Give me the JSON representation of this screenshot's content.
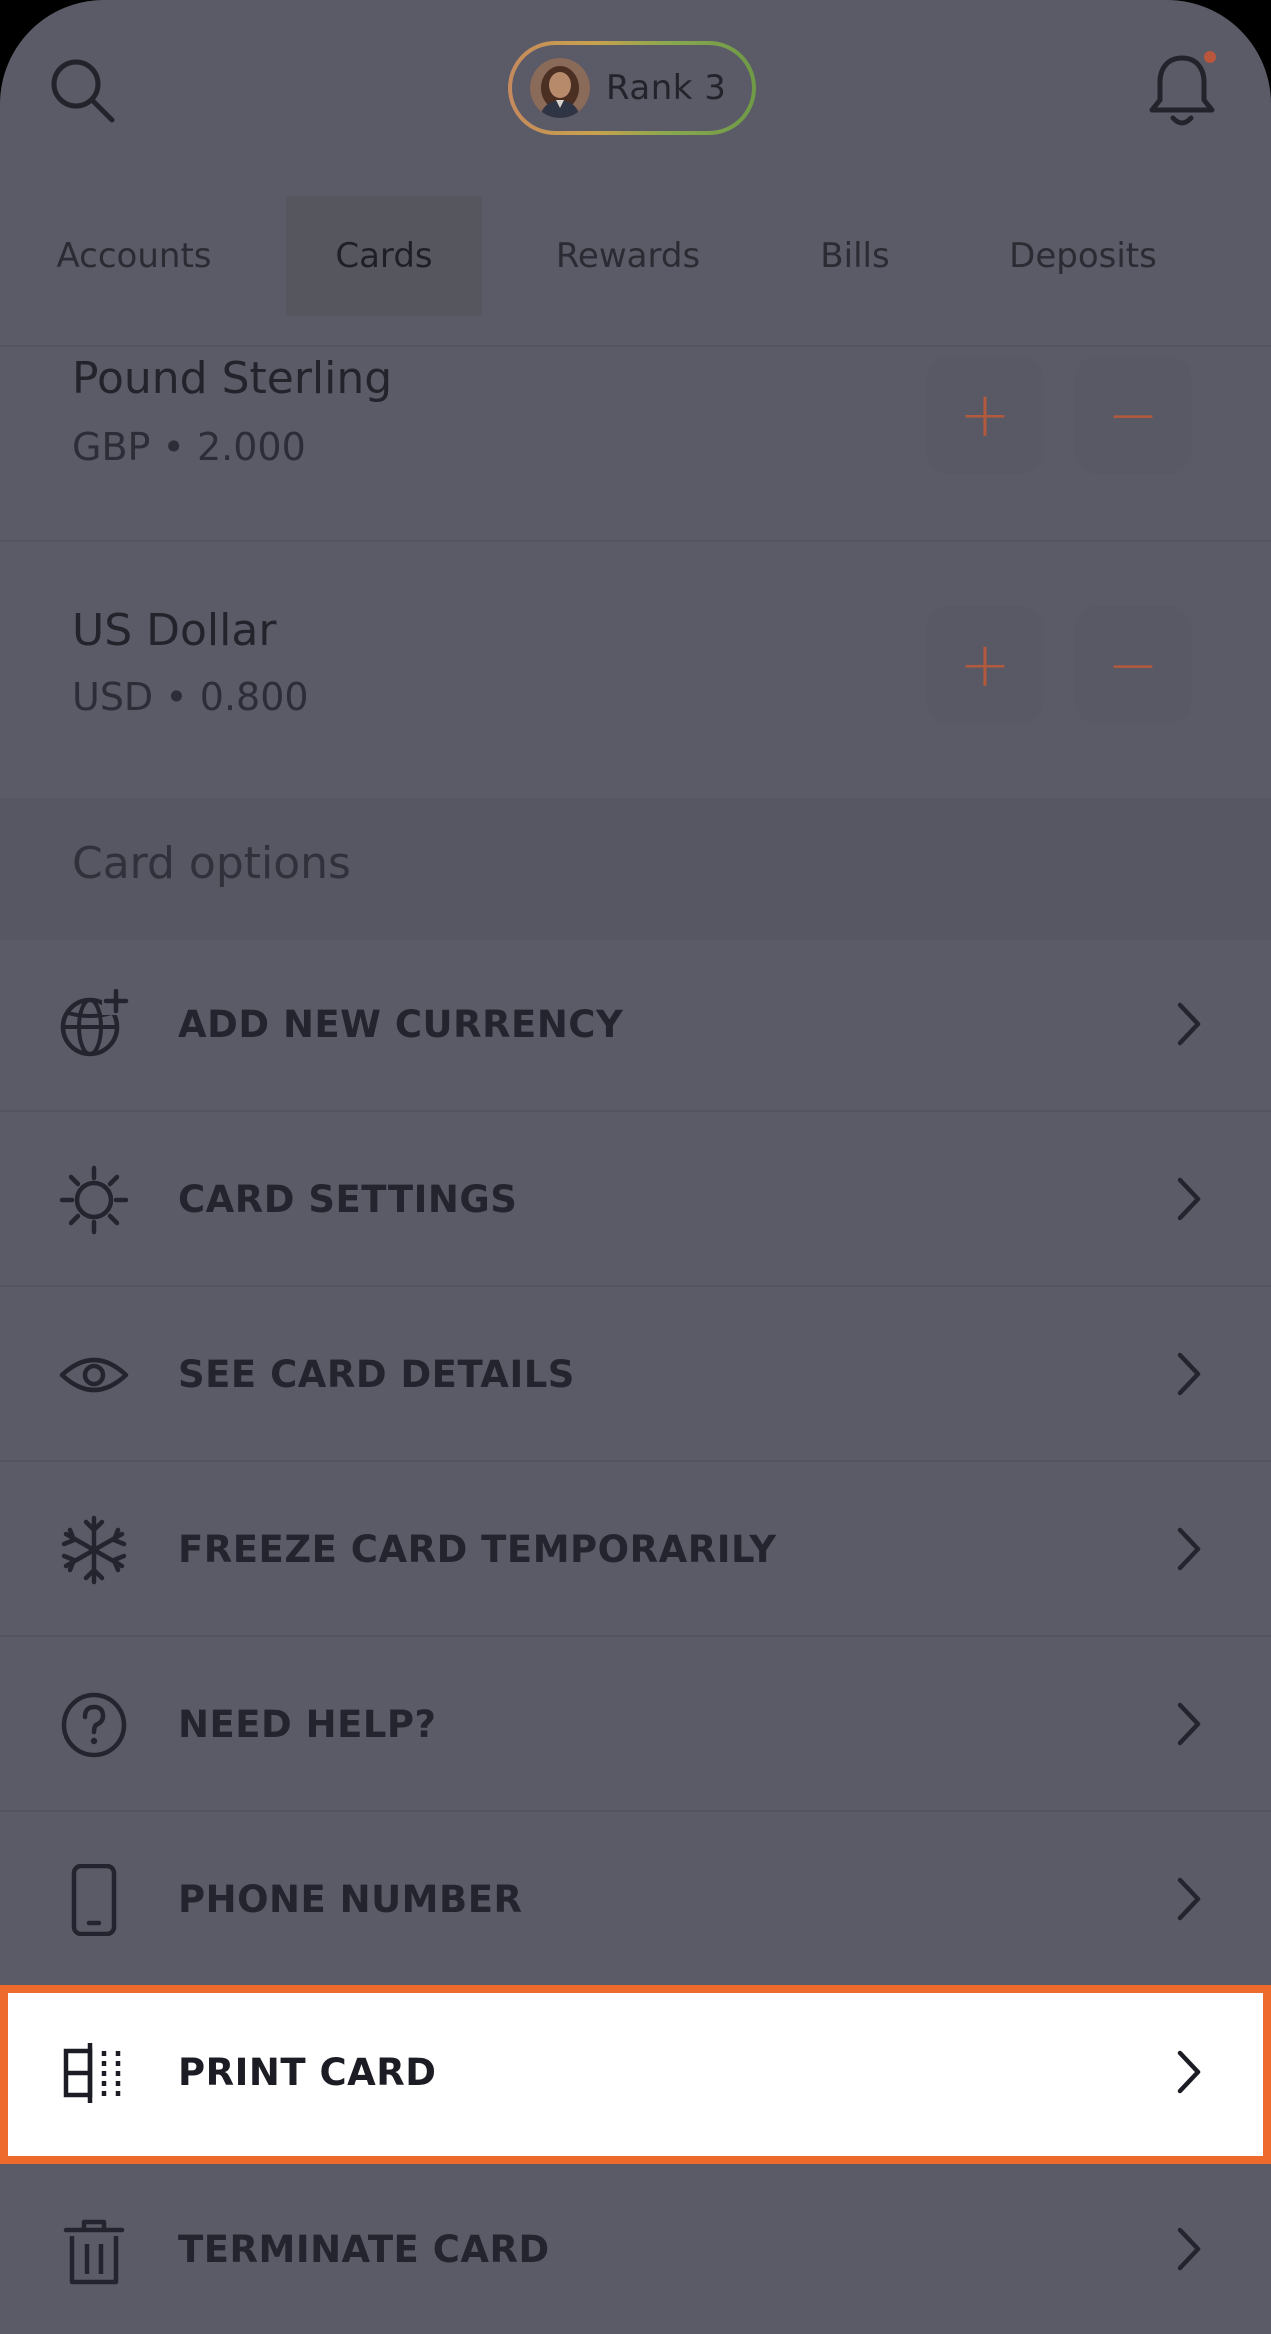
{
  "header": {
    "rank_label": "Rank 3",
    "icons": [
      "search-icon",
      "user-avatar",
      "bell-icon"
    ],
    "notification_dot_color": "#b9563b"
  },
  "tabs": [
    {
      "label": "Accounts",
      "active": false
    },
    {
      "label": "Cards",
      "active": true
    },
    {
      "label": "Rewards",
      "active": false
    },
    {
      "label": "Bills",
      "active": false
    },
    {
      "label": "Deposits",
      "active": false
    }
  ],
  "currencies": [
    {
      "name": "Pound Sterling",
      "detail": "GBP • 2.000",
      "plus": "+",
      "minus": "−"
    },
    {
      "name": "US Dollar",
      "detail": "USD • 0.800",
      "plus": "+",
      "minus": "−"
    }
  ],
  "card_options": {
    "title": "Card options",
    "items": [
      {
        "label": "ADD NEW CURRENCY",
        "icon": "globe-plus-icon"
      },
      {
        "label": "CARD SETTINGS",
        "icon": "gear-icon"
      },
      {
        "label": "SEE CARD DETAILS",
        "icon": "eye-icon"
      },
      {
        "label": "FREEZE CARD TEMPORARILY",
        "icon": "snowflake-icon"
      },
      {
        "label": "NEED HELP?",
        "icon": "help-circle-icon"
      },
      {
        "label": "PHONE NUMBER",
        "icon": "phone-icon"
      },
      {
        "label": "PRINT CARD",
        "icon": "print-card-icon",
        "highlighted": true
      },
      {
        "label": "TERMINATE CARD",
        "icon": "trash-icon"
      }
    ]
  },
  "colors": {
    "overlay_background": "#5b5b68",
    "accent_orange": "#ee6a2c",
    "currency_button_symbol": "#b45a3c"
  }
}
